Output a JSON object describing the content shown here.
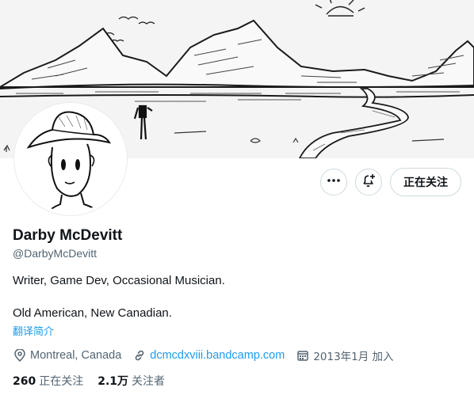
{
  "profile": {
    "name": "Darby McDevitt",
    "handle": "@DarbyMcDevitt",
    "bio_line1": "Writer, Game Dev, Occasional Musician.",
    "bio_line2": "Old American, New Canadian.",
    "translate_label": "翻译简介",
    "location": "Montreal, Canada",
    "website": "dcmcdxviii.bandcamp.com",
    "joined": "2013年1月 加入"
  },
  "actions": {
    "more_icon": "more-horizontal-icon",
    "notify_icon": "bell-plus-icon",
    "follow_label": "正在关注"
  },
  "stats": {
    "following_count": "260",
    "following_label": "正在关注",
    "followers_count": "2.1万",
    "followers_label": "关注者"
  },
  "icons": {
    "location": "location-pin-icon",
    "website": "link-icon",
    "joined": "calendar-icon"
  },
  "colors": {
    "link": "#1d9bf0",
    "secondary_text": "#536471",
    "border": "#cfd9de"
  }
}
